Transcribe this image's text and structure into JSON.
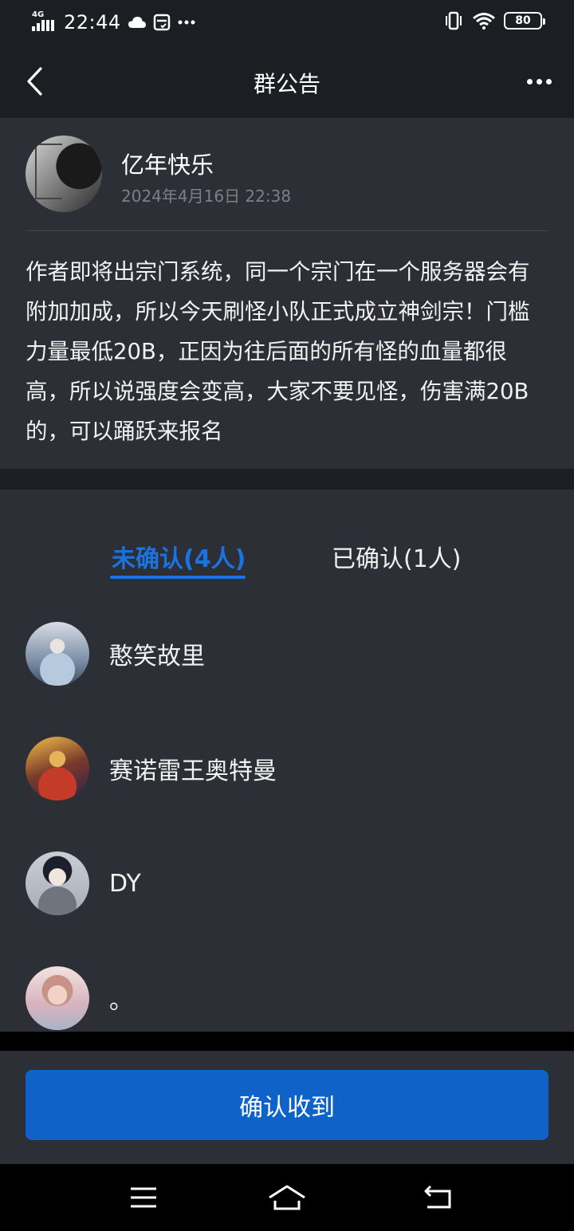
{
  "status_bar": {
    "network": "4G",
    "time": "22:44",
    "battery": "80"
  },
  "header": {
    "title": "群公告"
  },
  "post": {
    "author": "亿年快乐",
    "timestamp": "2024年4月16日 22:38",
    "body": "作者即将出宗门系统，同一个宗门在一个服务器会有附加加成，所以今天刷怪小队正式成立神剑宗！门槛力量最低20B，正因为往后面的所有怪的血量都很高，所以说强度会变高，大家不要见怪，伤害满20B的，可以踊跃来报名"
  },
  "tabs": {
    "unconfirmed": "未确认(4人)",
    "confirmed": "已确认(1人)"
  },
  "members": [
    {
      "name": "憨笑故里"
    },
    {
      "name": "赛诺雷王奥特曼"
    },
    {
      "name": "DY"
    },
    {
      "name": "。"
    }
  ],
  "actions": {
    "confirm_label": "确认收到"
  },
  "colors": {
    "accent": "#1a73e0",
    "button": "#0f63c8",
    "background": "#2c2f35",
    "header": "#1b1e22"
  }
}
